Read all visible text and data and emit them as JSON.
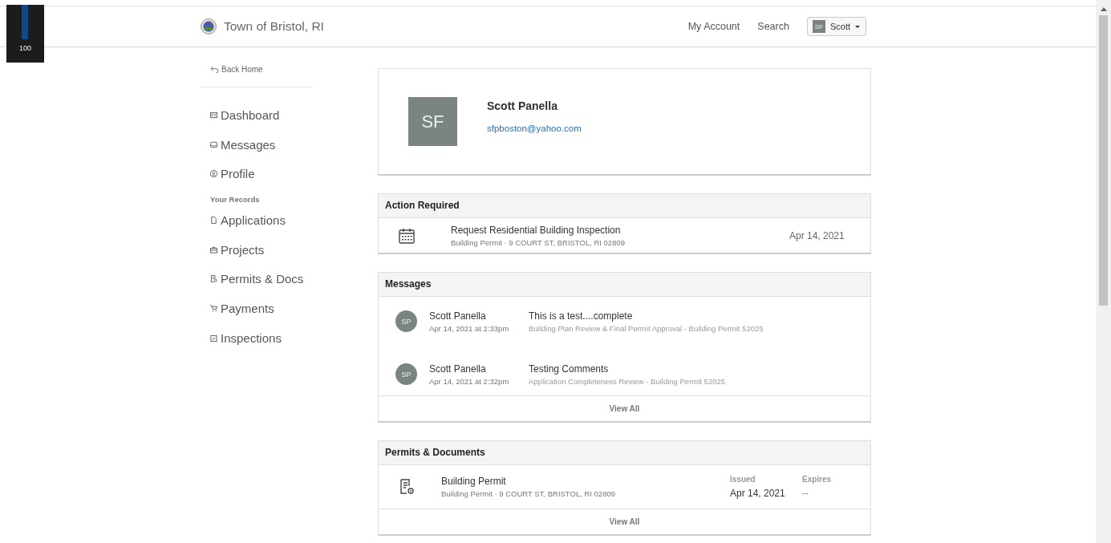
{
  "meter": {
    "reading": "100"
  },
  "header": {
    "brand": "Town of Bristol, RI",
    "links": [
      "My Account",
      "Search"
    ],
    "user_menu": {
      "initials": "SF",
      "label": "Scott"
    }
  },
  "sidebar": {
    "back": "Back Home",
    "items": [
      {
        "label": "Dashboard"
      },
      {
        "label": "Messages"
      },
      {
        "label": "Profile"
      }
    ],
    "section": "Your Records",
    "records": [
      {
        "label": "Applications"
      },
      {
        "label": "Projects"
      },
      {
        "label": "Permits & Docs"
      },
      {
        "label": "Payments"
      },
      {
        "label": "Inspections"
      }
    ]
  },
  "profile": {
    "initials": "SF",
    "name": "Scott Panella",
    "email": "sfpboston@yahoo.com"
  },
  "action_required": {
    "title": "Action Required",
    "rows": [
      {
        "title": "Request Residential Building Inspection",
        "subtitle": "Building Permit · 9 COURT ST, BRISTOL, RI 02809",
        "date": "Apr 14, 2021"
      }
    ]
  },
  "messages": {
    "title": "Messages",
    "rows": [
      {
        "initials": "SP",
        "sender": "Scott Panella",
        "time": "Apr 14, 2021 at 2:33pm",
        "subject": "This is a test....complete",
        "context": "Building Plan Review & Final Permit Approval - Building Permit 52025"
      },
      {
        "initials": "SP",
        "sender": "Scott Panella",
        "time": "Apr 14, 2021 at 2:32pm",
        "subject": "Testing Comments",
        "context": "Application Completeness Review - Building Permit 52025"
      }
    ],
    "view_all": "View All"
  },
  "permits": {
    "title": "Permits & Documents",
    "rows": [
      {
        "title": "Building Permit",
        "subtitle": "Building Permit · 9 COURT ST, BRISTOL, RI 02809",
        "issued_label": "Issued",
        "issued": "Apr 14, 2021",
        "expires_label": "Expires",
        "expires": "--"
      }
    ],
    "view_all": "View All"
  }
}
